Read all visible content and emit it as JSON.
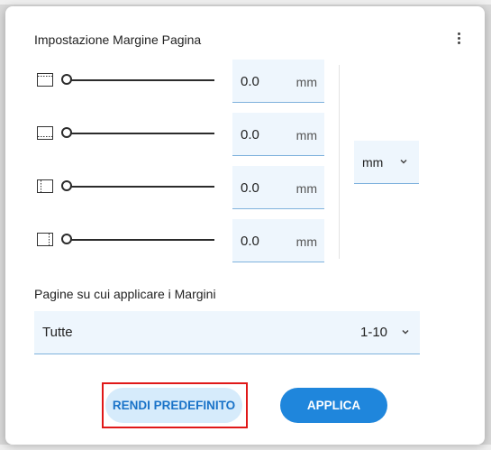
{
  "dialog": {
    "title": "Impostazione Margine Pagina",
    "menu_icon": "more-vertical-icon"
  },
  "margins": [
    {
      "side": "top",
      "icon": "margin-top-icon",
      "value": "0.0",
      "unit": "mm",
      "slider_level": 0
    },
    {
      "side": "bottom",
      "icon": "margin-bottom-icon",
      "value": "0.0",
      "unit": "mm",
      "slider_level": 0
    },
    {
      "side": "left",
      "icon": "margin-left-icon",
      "value": "0.0",
      "unit": "mm",
      "slider_level": 0
    },
    {
      "side": "right",
      "icon": "margin-right-icon",
      "value": "0.0",
      "unit": "mm",
      "slider_level": 0
    }
  ],
  "unit_select": {
    "value": "mm"
  },
  "pages": {
    "label": "Pagine su cui applicare i Margini",
    "value": "Tutte",
    "range": "1-10"
  },
  "buttons": {
    "make_default": "RENDI PREDEFINITO",
    "apply": "APPLICA"
  },
  "colors": {
    "primary": "#1f86dc",
    "highlight": "#e01818"
  }
}
